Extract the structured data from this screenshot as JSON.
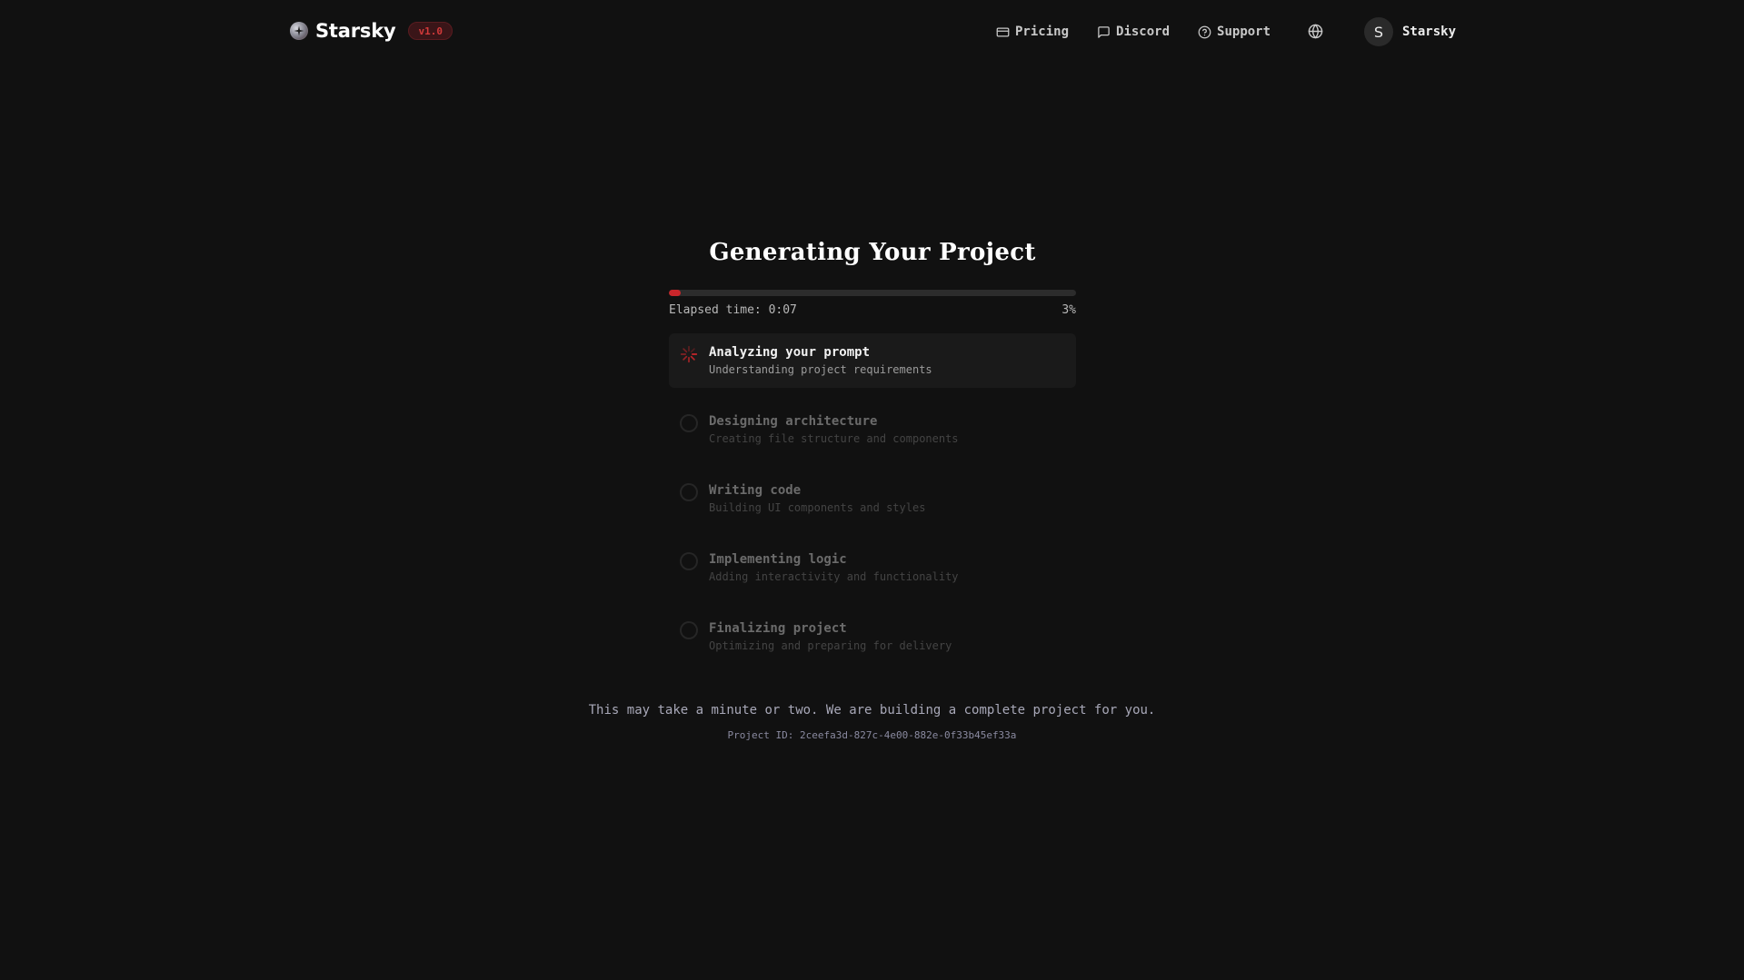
{
  "header": {
    "brand_name": "Starsky",
    "version": "v1.0",
    "nav": {
      "pricing": "Pricing",
      "discord": "Discord",
      "support": "Support"
    },
    "user": {
      "avatar_initial": "S",
      "name": "Starsky"
    }
  },
  "main": {
    "title": "Generating Your Project",
    "progress_percent": 3,
    "progress_label": "3%",
    "elapsed": "Elapsed time: 0:07",
    "accent_color": "#c9262b"
  },
  "steps": [
    {
      "title": "Analyzing your prompt",
      "desc": "Understanding project requirements",
      "status": "active"
    },
    {
      "title": "Designing architecture",
      "desc": "Creating file structure and components",
      "status": "pending"
    },
    {
      "title": "Writing code",
      "desc": "Building UI components and styles",
      "status": "pending"
    },
    {
      "title": "Implementing logic",
      "desc": "Adding interactivity and functionality",
      "status": "pending"
    },
    {
      "title": "Finalizing project",
      "desc": "Optimizing and preparing for delivery",
      "status": "pending"
    }
  ],
  "footer": {
    "note": "This may take a minute or two. We are building a complete project for you.",
    "project_id": "Project ID: 2ceefa3d-827c-4e00-882e-0f33b45ef33a"
  },
  "icons": {
    "brand": "starsky-logo-icon",
    "pricing": "credit-card-icon",
    "discord": "message-square-icon",
    "support": "help-circle-icon",
    "language": "globe-icon",
    "active_step": "spinner-icon",
    "pending_step": "empty-circle-icon"
  }
}
